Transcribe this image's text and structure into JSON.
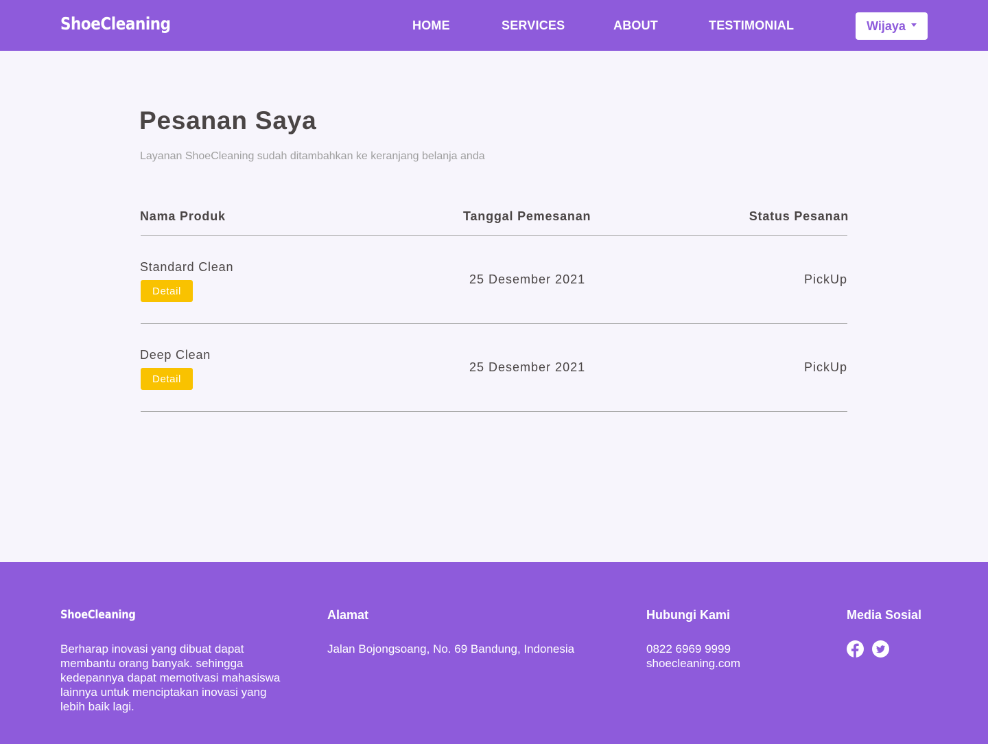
{
  "navbar": {
    "brand": "ShoeCleaning",
    "links": [
      "HOME",
      "SERVICES",
      "ABOUT",
      "TESTIMONIAL"
    ],
    "user": "Wijaya"
  },
  "main": {
    "title": "Pesanan Saya",
    "subtitle": "Layanan ShoeCleaning sudah ditambahkan ke keranjang belanja anda",
    "headers": [
      "Nama Produk",
      "Tanggal Pemesanan",
      "Status Pesanan"
    ],
    "orders": [
      {
        "name": "Standard Clean",
        "button": "Detail",
        "date": "25 Desember 2021",
        "status": "PickUp"
      },
      {
        "name": "Deep Clean",
        "button": "Detail",
        "date": "25 Desember 2021",
        "status": "PickUp"
      }
    ]
  },
  "footer": {
    "brand": "ShoeCleaning",
    "description": "Berharap inovasi yang dibuat dapat membantu orang banyak. sehingga kedepannya dapat memotivasi mahasiswa lainnya untuk menciptakan inovasi yang lebih baik lagi.",
    "address_title": "Alamat",
    "address": "Jalan Bojongsoang, No. 69 Bandung, Indonesia",
    "contact_title": "Hubungi Kami",
    "phone": "0822 6969 9999",
    "website": "shoecleaning.com",
    "social_title": "Media Sosial",
    "social_icons": [
      "facebook-icon",
      "twitter-icon"
    ]
  },
  "colors": {
    "primary": "#8e5bdb",
    "accent": "#f9c200",
    "background": "#f7f5fc",
    "text": "#4a4545"
  }
}
